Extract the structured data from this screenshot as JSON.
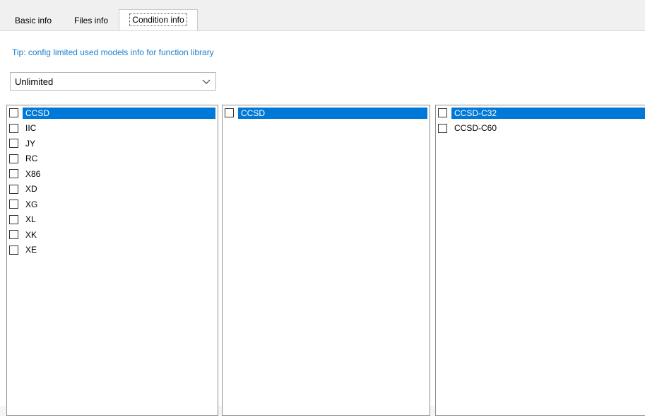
{
  "tabs": [
    {
      "label": "Basic info"
    },
    {
      "label": "Files info"
    },
    {
      "label": "Condition info"
    }
  ],
  "tip": "Tip: config limited used models info for function library",
  "limit_select": {
    "value": "Unlimited"
  },
  "lists": {
    "vendors": [
      "CCSD",
      "IIC",
      "JY",
      "RC",
      "X86",
      "XD",
      "XG",
      "XL",
      "XK",
      "XE"
    ],
    "series": [
      "CCSD"
    ],
    "models": [
      "CCSD-C32",
      "CCSD-C60"
    ]
  },
  "colors": {
    "selection": "#0078d7",
    "tip_text": "#1a7fd0"
  }
}
